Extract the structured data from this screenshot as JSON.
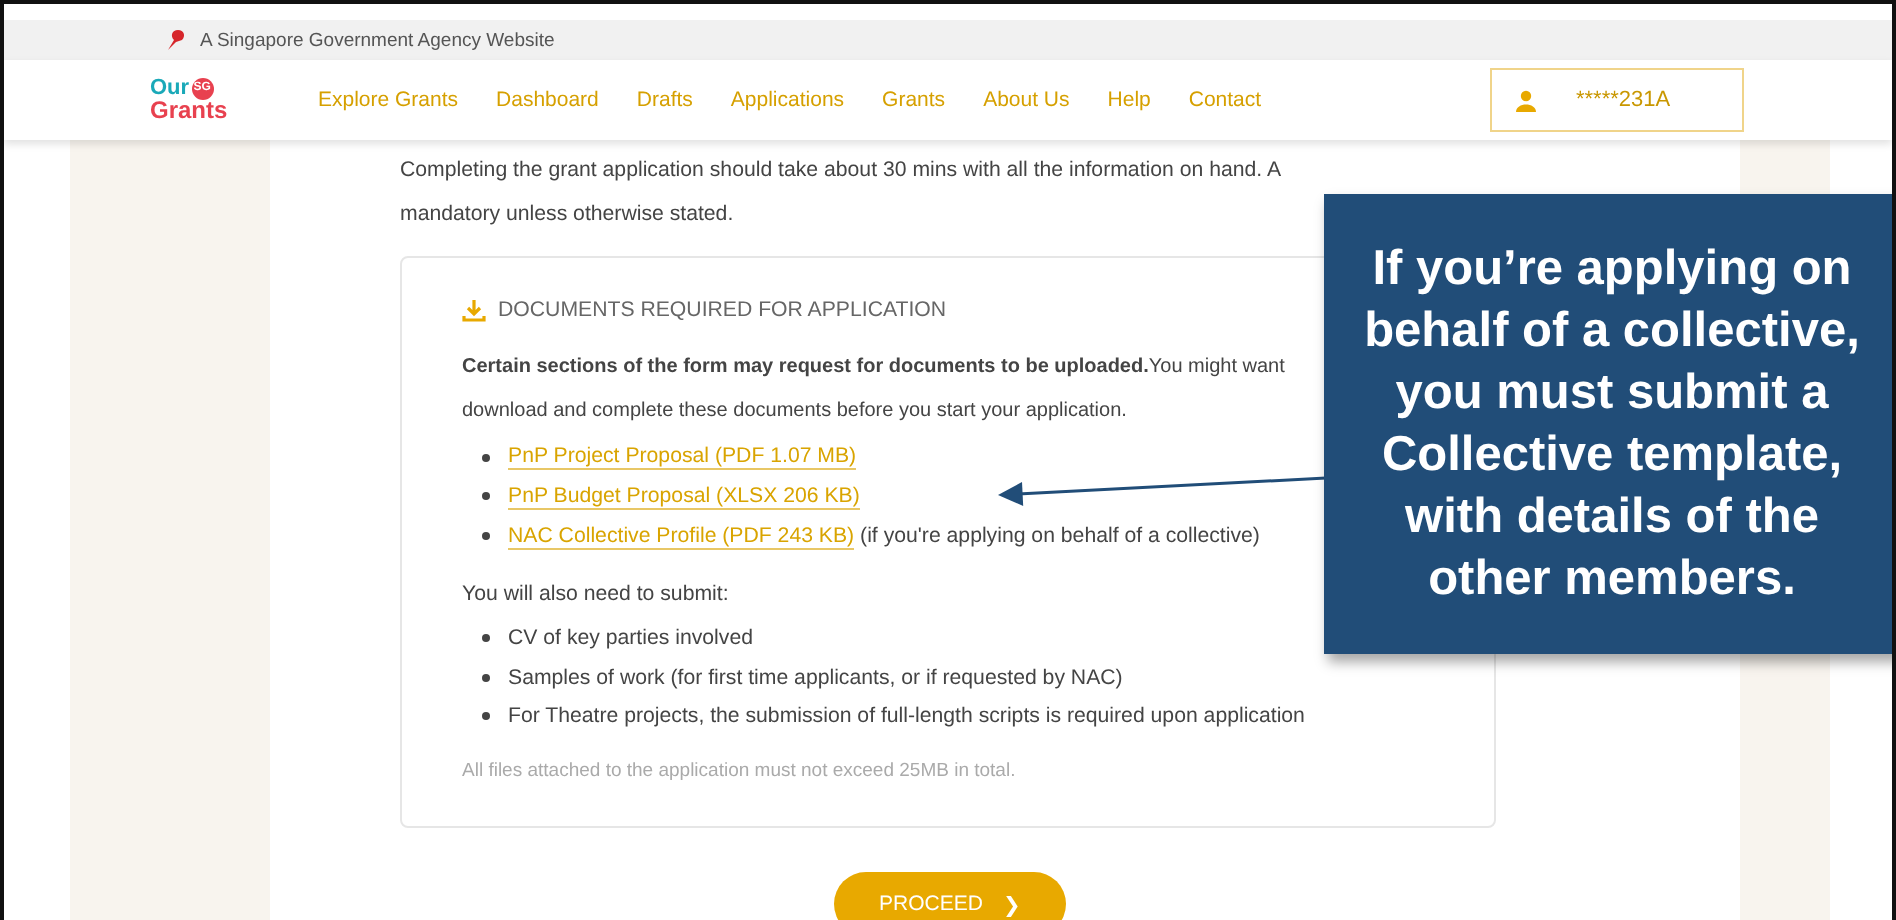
{
  "gov_banner": {
    "text": "A Singapore Government Agency Website"
  },
  "logo": {
    "top": "Our",
    "badge": "SG",
    "bottom": "Grants"
  },
  "nav": {
    "items": [
      "Explore Grants",
      "Dashboard",
      "Drafts",
      "Applications",
      "Grants",
      "About Us",
      "Help",
      "Contact"
    ],
    "user": "*****231A"
  },
  "intro": {
    "lines": [
      "Completing the grant application should take about 30 mins with all the information on hand. A",
      "mandatory unless otherwise stated."
    ]
  },
  "documents_card": {
    "title": "DOCUMENTS REQUIRED FOR APPLICATION",
    "lead": {
      "lines": [
        "**Certain sections of the form may request for documents to be uploaded.**You might want",
        "download and complete these documents before you start your application."
      ]
    },
    "documents": [
      {
        "link": "PnP Project Proposal (PDF 1.07 MB)"
      },
      {
        "link": "PnP Budget Proposal (XLSX 206 KB)"
      },
      {
        "link": "NAC Collective Profile (PDF 243 KB)",
        "note": "(if you're applying on behalf of a collective)"
      }
    ],
    "also_heading": "You will also need to submit:",
    "also_items": [
      "CV of key parties involved",
      "Samples of work (for first time applicants, or if requested by NAC)",
      "For Theatre projects, the submission of full-length scripts is required upon application"
    ],
    "footnote": "All files attached to the application must not exceed 25MB in total."
  },
  "proceed_button": {
    "label": "PROCEED",
    "icon": "❯"
  },
  "callout": {
    "text": "If you’re applying on behalf of a collective, you must submit a Collective template, with details of the other members."
  }
}
